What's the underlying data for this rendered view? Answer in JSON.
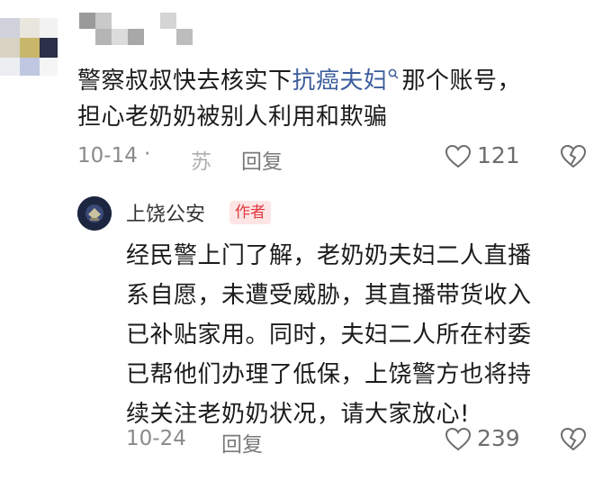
{
  "comment": {
    "text_before": "警察叔叔快去核实下",
    "highlight": "抗癌夫妇",
    "text_after_line1": "那个账号，",
    "line2": "担心老奶奶被别人利用和欺骗",
    "date": "10-14",
    "separator": "·",
    "location": "苏",
    "reply_label": "回复",
    "likes": "121"
  },
  "reply": {
    "author": "上饶公安",
    "badge": "作者",
    "lines": [
      "经民警上门了解，老奶奶夫妇二人直播",
      "系自愿，未遭受威胁，其直播带货收入",
      "已补贴家用。同时，夫妇二人所在村委",
      "已帮他们办理了低保，上饶警方也将持",
      "续关注老奶奶状况，请大家放心!"
    ],
    "date": "10-24",
    "reply_label": "回复",
    "likes": "239"
  },
  "icons": {
    "search": "search-icon",
    "like": "heart-outline-icon",
    "dislike": "broken-heart-icon"
  },
  "colors": {
    "link": "#3b5d9c",
    "badge_bg": "#fde5e5",
    "badge_text": "#e0393e",
    "meta": "#8a8a8a"
  }
}
